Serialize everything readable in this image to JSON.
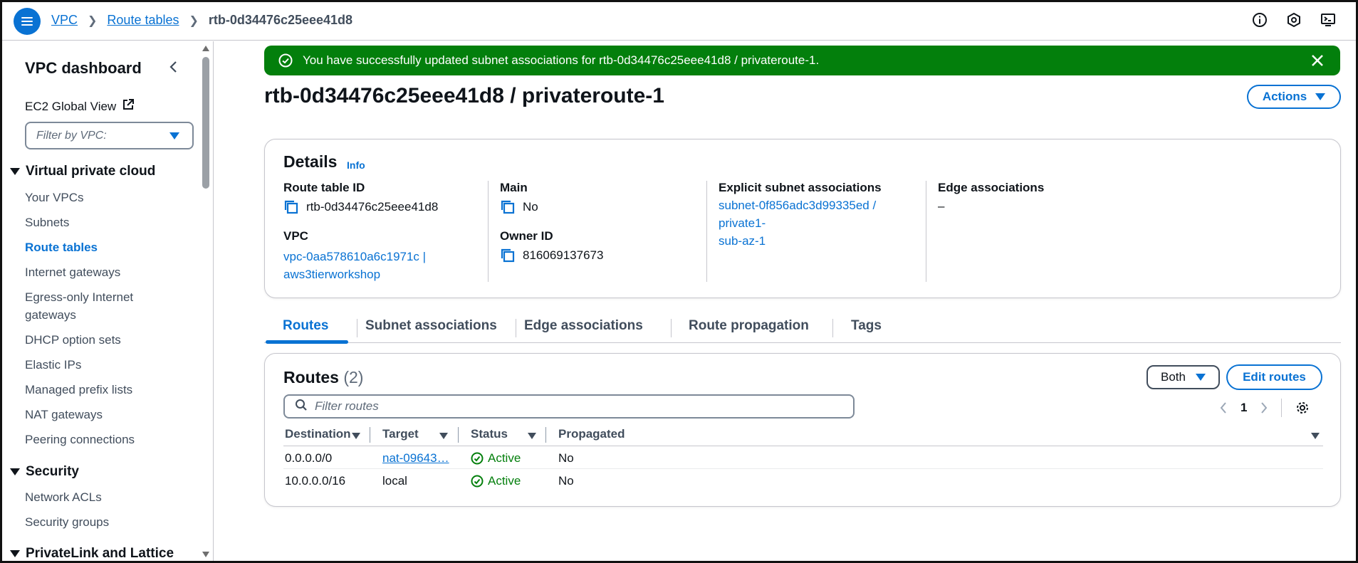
{
  "breadcrumb": {
    "items": [
      "VPC",
      "Route tables"
    ],
    "current": "rtb-0d34476c25eee41d8"
  },
  "top_icons": [
    "info-icon",
    "settings-hex-icon",
    "cloudshell-icon"
  ],
  "sidebar": {
    "title": "VPC dashboard",
    "ec2_global_view": "EC2 Global View",
    "filter_placeholder": "Filter by VPC:",
    "sections": [
      {
        "label": "Virtual private cloud",
        "items": [
          "Your VPCs",
          "Subnets",
          "Route tables",
          "Internet gateways",
          "Egress-only Internet gateways",
          "DHCP option sets",
          "Elastic IPs",
          "Managed prefix lists",
          "NAT gateways",
          "Peering connections"
        ]
      },
      {
        "label": "Security",
        "items": [
          "Network ACLs",
          "Security groups"
        ]
      },
      {
        "label": "PrivateLink and Lattice",
        "items": []
      }
    ],
    "active_item": "Route tables"
  },
  "flash": {
    "message": "You have successfully updated subnet associations for rtb-0d34476c25eee41d8 / privateroute-1.",
    "color": "#037f0c"
  },
  "page_title": "rtb-0d34476c25eee41d8 / privateroute-1",
  "actions_label": "Actions",
  "details": {
    "title": "Details",
    "info": "Info",
    "route_table_id_label": "Route table ID",
    "route_table_id": "rtb-0d34476c25eee41d8",
    "vpc_label": "VPC",
    "vpc_line1": "vpc-0aa578610a6c1971c |",
    "vpc_line2": "aws3tierworkshop",
    "main_label": "Main",
    "main_value": "No",
    "owner_label": "Owner ID",
    "owner_value": "816069137673",
    "explicit_label": "Explicit subnet associations",
    "explicit_line1": "subnet-0f856adc3d99335ed / private1-",
    "explicit_line2": "sub-az-1",
    "edge_label": "Edge associations",
    "edge_value": "–"
  },
  "tabs": [
    "Routes",
    "Subnet associations",
    "Edge associations",
    "Route propagation",
    "Tags"
  ],
  "routes": {
    "title": "Routes",
    "count": "(2)",
    "both_label": "Both",
    "edit_label": "Edit routes",
    "search_placeholder": "Filter routes",
    "page": "1",
    "columns": [
      "Destination",
      "Target",
      "Status",
      "Propagated"
    ],
    "rows": [
      {
        "destination": "0.0.0.0/0",
        "target": "nat-09643…",
        "status": "Active",
        "propagated": "No"
      },
      {
        "destination": "10.0.0.0/16",
        "target": "local",
        "status": "Active",
        "propagated": "No"
      }
    ]
  },
  "colors": {
    "accent": "#0972d3",
    "success": "#037f0c",
    "text": "#0f141a"
  }
}
